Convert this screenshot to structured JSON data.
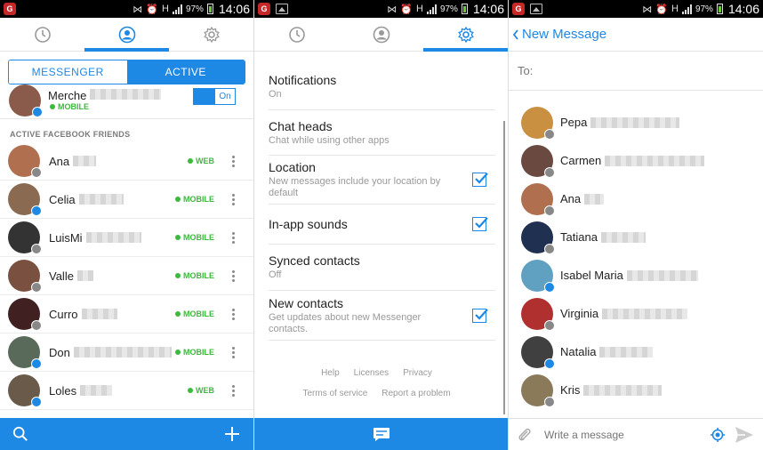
{
  "status": {
    "battery": "97%",
    "time": "14:06"
  },
  "screen1": {
    "segment": {
      "left": "MESSENGER",
      "right": "ACTIVE"
    },
    "me": {
      "name": "Merche",
      "status": "MOBILE",
      "toggle": "On"
    },
    "section": "ACTIVE FACEBOOK FRIENDS",
    "friends": [
      {
        "name": "Ana",
        "status": "WEB",
        "color": "#b07050"
      },
      {
        "name": "Celia",
        "status": "MOBILE",
        "color": "#8a6a50"
      },
      {
        "name": "LuisMi",
        "status": "MOBILE",
        "color": "#333333"
      },
      {
        "name": "Valle",
        "status": "MOBILE",
        "color": "#7a5040"
      },
      {
        "name": "Curro",
        "status": "MOBILE",
        "color": "#402020"
      },
      {
        "name": "Don",
        "status": "MOBILE",
        "color": "#5a6a5a"
      },
      {
        "name": "Loles",
        "status": "WEB",
        "color": "#6a5a4a"
      }
    ]
  },
  "screen2": {
    "settings": [
      {
        "title": "Notifications",
        "sub": "On",
        "checked": false
      },
      {
        "title": "Chat heads",
        "sub": "Chat while using other apps",
        "checked": false
      },
      {
        "title": "Location",
        "sub": "New messages include your location by default",
        "checked": true
      },
      {
        "title": "In-app sounds",
        "sub": "",
        "checked": true
      },
      {
        "title": "Synced contacts",
        "sub": "Off",
        "checked": false
      },
      {
        "title": "New contacts",
        "sub": "Get updates about new Messenger contacts.",
        "checked": true
      }
    ],
    "links": {
      "help": "Help",
      "licenses": "Licenses",
      "privacy": "Privacy",
      "terms": "Terms of service",
      "report": "Report a problem"
    }
  },
  "screen3": {
    "title": "New Message",
    "to_label": "To:",
    "contacts": [
      {
        "name": "Pepa",
        "color": "#c89040"
      },
      {
        "name": "Carmen",
        "color": "#6a4a40"
      },
      {
        "name": "Ana",
        "color": "#b07050"
      },
      {
        "name": "Tatiana",
        "color": "#203050"
      },
      {
        "name": "Isabel Maria",
        "color": "#60a0c0"
      },
      {
        "name": "Virginia",
        "color": "#b03030"
      },
      {
        "name": "Natalia",
        "color": "#404040"
      },
      {
        "name": "Kris",
        "color": "#8a7a5a"
      }
    ],
    "placeholder": "Write a message"
  }
}
